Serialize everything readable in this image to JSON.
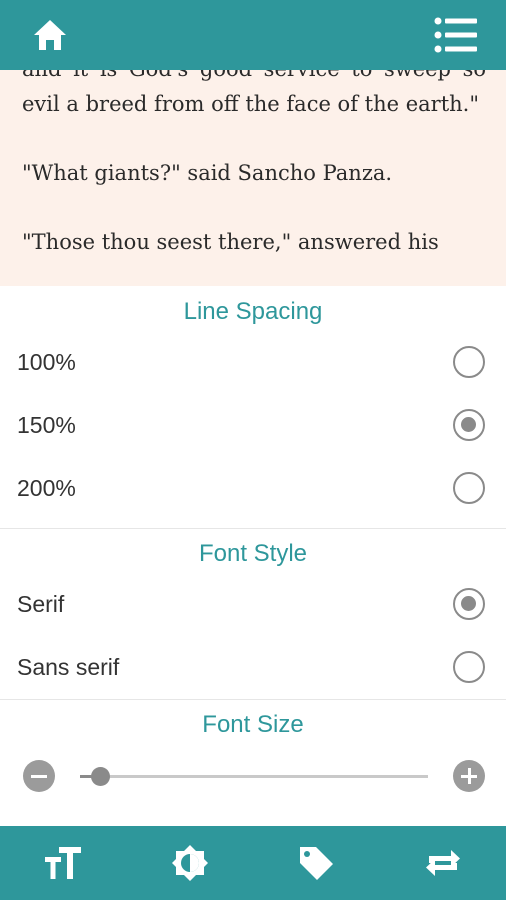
{
  "toolbar": {
    "home_icon": "home-icon",
    "menu_icon": "list-menu-icon"
  },
  "reader": {
    "paragraphs": [
      "and it is God's good service to sweep so evil a breed from off the face of the earth.\"",
      "\"What giants?\" said Sancho Panza.",
      "\"Those thou seest there,\" answered his"
    ]
  },
  "line_spacing": {
    "title": "Line Spacing",
    "options": [
      {
        "label": "100%",
        "selected": false
      },
      {
        "label": "150%",
        "selected": true
      },
      {
        "label": "200%",
        "selected": false
      }
    ]
  },
  "font_style": {
    "title": "Font Style",
    "options": [
      {
        "label": "Serif",
        "selected": true
      },
      {
        "label": "Sans serif",
        "selected": false
      }
    ]
  },
  "font_size": {
    "title": "Font Size",
    "level_fraction": 0.06
  },
  "bottom_nav": {
    "items": [
      "text-size-icon",
      "brightness-icon",
      "tag-icon",
      "swap-icon"
    ]
  },
  "colors": {
    "accent": "#2e979b",
    "reader_background": "#fdf1ea",
    "control_gray": "#8a8a8a"
  }
}
